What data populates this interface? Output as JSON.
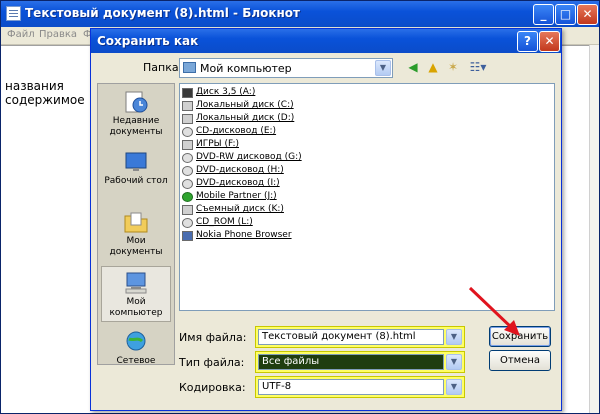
{
  "notepad": {
    "title": "Текстовый документ (8).html - Блокнот",
    "menu": [
      "Файл",
      "Правка",
      "Ф"
    ],
    "content_lines": [
      "названия",
      "содержимое"
    ]
  },
  "dialog": {
    "title": "Сохранить как",
    "folder_label": "Папка:",
    "folder_value": "Мой компьютер",
    "places": [
      {
        "label": "Недавние документы"
      },
      {
        "label": "Рабочий стол"
      },
      {
        "label": "Мои документы"
      },
      {
        "label": "Мой компьютер"
      },
      {
        "label": "Сетевое"
      }
    ],
    "files": [
      {
        "name": "Диск 3,5 (A:)",
        "icon": "floppy"
      },
      {
        "name": "Локальный диск (C:)",
        "icon": "drive"
      },
      {
        "name": "Локальный диск (D:)",
        "icon": "drive"
      },
      {
        "name": "CD-дисковод (E:)",
        "icon": "cd"
      },
      {
        "name": "ИГРЫ (F:)",
        "icon": "drive"
      },
      {
        "name": "DVD-RW дисковод (G:)",
        "icon": "cd"
      },
      {
        "name": "DVD-дисковод (H:)",
        "icon": "cd"
      },
      {
        "name": "DVD-дисковод (I:)",
        "icon": "cd"
      },
      {
        "name": "Mobile Partner (J:)",
        "icon": "green"
      },
      {
        "name": "Съемный диск (K:)",
        "icon": "drive"
      },
      {
        "name": "CD_ROM (L:)",
        "icon": "cd"
      },
      {
        "name": "Nokia Phone Browser",
        "icon": "phone"
      }
    ],
    "filename_label": "Имя файла:",
    "filename_value": "Текстовый документ (8).html",
    "filetype_label": "Тип файла:",
    "filetype_value": "Все файлы",
    "encoding_label": "Кодировка:",
    "encoding_value": "UTF-8",
    "save_button": "Сохранить",
    "cancel_button": "Отмена"
  },
  "colors": {
    "highlight": "#ffff66",
    "title_bar": "#0a52d9",
    "arrow": "#e0141e"
  }
}
